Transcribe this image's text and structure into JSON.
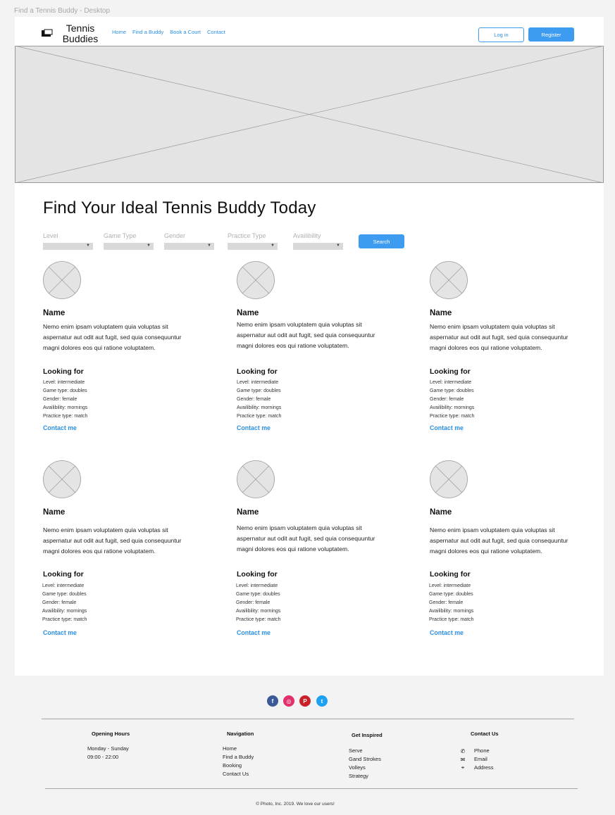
{
  "frame_title": "Find a Tennis Buddy - Desktop",
  "header": {
    "logo_line1": "Tennis",
    "logo_line2": "Buddies",
    "nav": [
      "Home",
      "Find a  Buddy",
      "Book a Court",
      "Contact"
    ],
    "login_label": "Log in",
    "register_label": "Register"
  },
  "main": {
    "headline": "Find Your Ideal Tennis Buddy Today",
    "filters": [
      "Level",
      "Game Type",
      "Gender",
      "Practice Type",
      "Availibility"
    ],
    "search_label": "Search"
  },
  "card": {
    "name": "Name",
    "bio": "Nemo enim ipsam voluptatem quia voluptas sit aspernatur aut odit aut fugit, sed quia consequuntur magni dolores eos qui ratione voluptatem.",
    "looking_for": "Looking for",
    "attributes": [
      "Level: intermediate",
      "Game type: doubles",
      "Gender: female",
      "Availibility: mornings",
      "Practice type: match"
    ],
    "contact_label": "Contact me"
  },
  "footer": {
    "social": [
      {
        "icon": "facebook-icon",
        "glyph": "f",
        "color": "#3b5998"
      },
      {
        "icon": "instagram-icon",
        "glyph": "◎",
        "color": "#e1306c"
      },
      {
        "icon": "pinterest-icon",
        "glyph": "P",
        "color": "#cb2027"
      },
      {
        "icon": "twitter-icon",
        "glyph": "t",
        "color": "#1da1f2"
      }
    ],
    "opening_hours": {
      "title": "Opening Hours",
      "days": "Monday - Sunday",
      "times": "09:00 - 22:00"
    },
    "navigation": {
      "title": "Navigation",
      "items": [
        "Home",
        "Find a Buddy",
        "Booking",
        "Contact Us"
      ]
    },
    "get_inspired": {
      "title": "Get Inspired",
      "items": [
        "Serve",
        "Gand Strokes",
        "Volleys",
        "Strategy"
      ]
    },
    "contact": {
      "title": "Contact Us",
      "items": [
        "Phone",
        "Email",
        "Address"
      ]
    },
    "copyright": "© Photo, Inc. 2019. We love our users!"
  },
  "colors": {
    "accent": "#3d9cf0",
    "link": "#2b8fe3",
    "placeholder": "#e4e4e4"
  }
}
